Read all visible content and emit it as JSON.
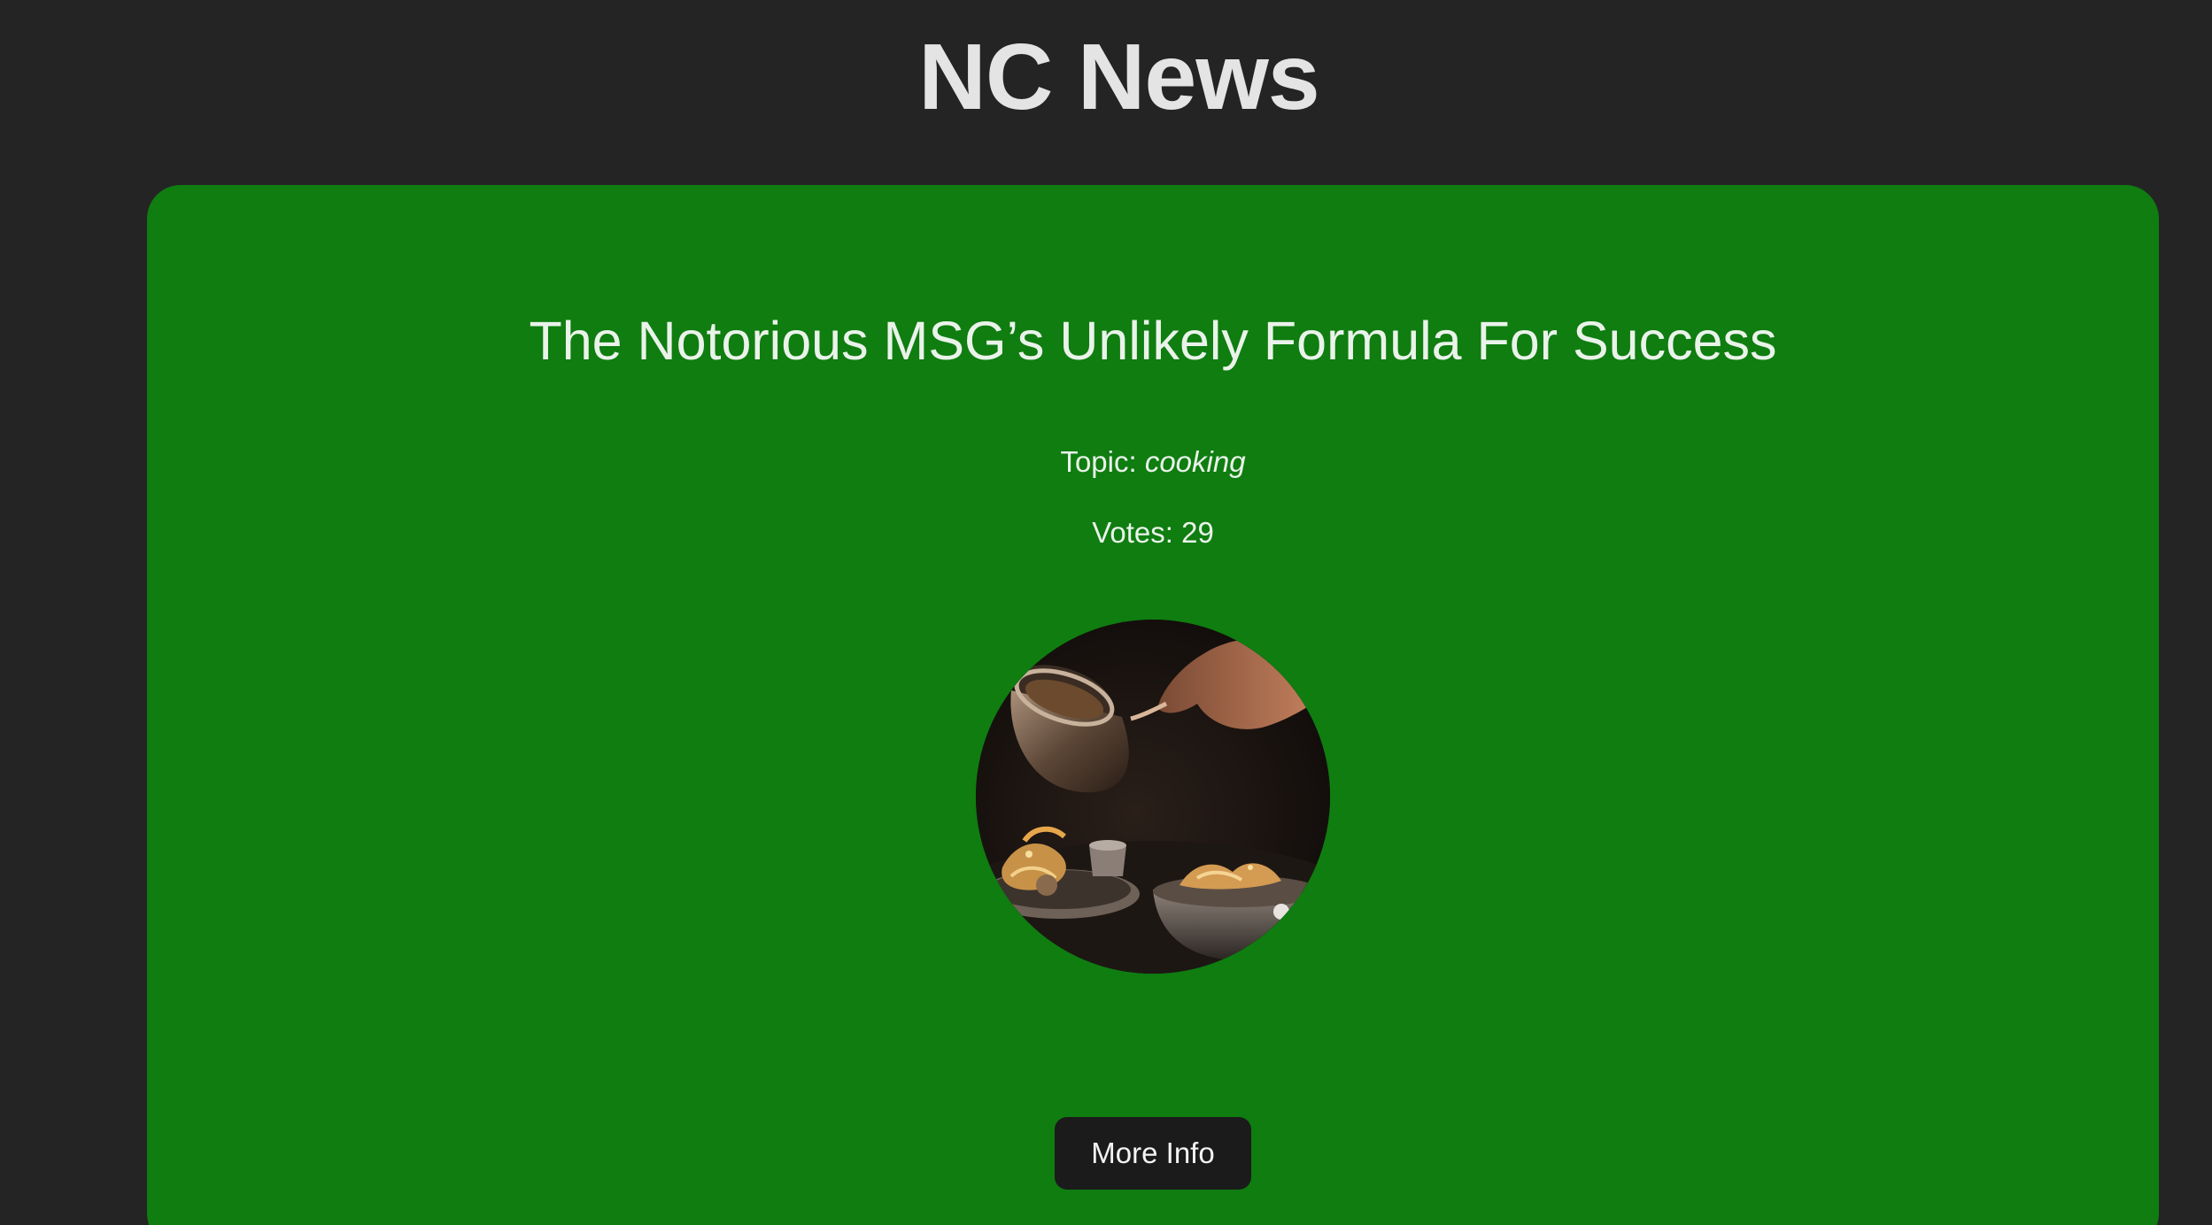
{
  "header": {
    "site_title": "NC News"
  },
  "article": {
    "title": "The Notorious MSG’s Unlikely Formula For Success",
    "topic_label": "Topic: ",
    "topic_value": "cooking",
    "votes_label": "Votes: ",
    "votes_value": "29",
    "image_alt": "Chef pouring sauce over plated dishes",
    "more_info_label": "More Info"
  },
  "colors": {
    "background": "#242424",
    "card": "#0f7d10",
    "button": "#1b1b1b",
    "text": "#eaf3ea"
  }
}
